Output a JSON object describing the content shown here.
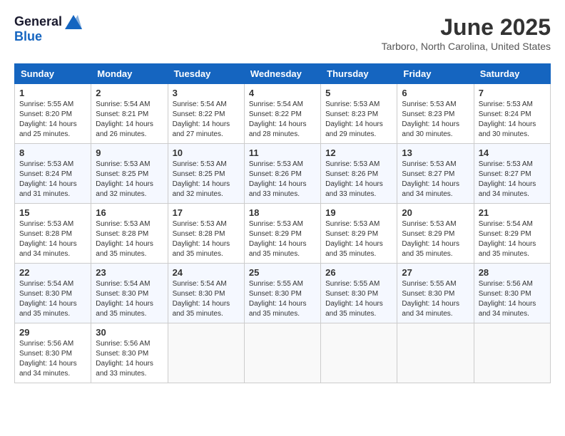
{
  "header": {
    "logo_general": "General",
    "logo_blue": "Blue",
    "title": "June 2025",
    "subtitle": "Tarboro, North Carolina, United States"
  },
  "weekdays": [
    "Sunday",
    "Monday",
    "Tuesday",
    "Wednesday",
    "Thursday",
    "Friday",
    "Saturday"
  ],
  "weeks": [
    [
      {
        "day": "1",
        "info": "Sunrise: 5:55 AM\nSunset: 8:20 PM\nDaylight: 14 hours\nand 25 minutes."
      },
      {
        "day": "2",
        "info": "Sunrise: 5:54 AM\nSunset: 8:21 PM\nDaylight: 14 hours\nand 26 minutes."
      },
      {
        "day": "3",
        "info": "Sunrise: 5:54 AM\nSunset: 8:22 PM\nDaylight: 14 hours\nand 27 minutes."
      },
      {
        "day": "4",
        "info": "Sunrise: 5:54 AM\nSunset: 8:22 PM\nDaylight: 14 hours\nand 28 minutes."
      },
      {
        "day": "5",
        "info": "Sunrise: 5:53 AM\nSunset: 8:23 PM\nDaylight: 14 hours\nand 29 minutes."
      },
      {
        "day": "6",
        "info": "Sunrise: 5:53 AM\nSunset: 8:23 PM\nDaylight: 14 hours\nand 30 minutes."
      },
      {
        "day": "7",
        "info": "Sunrise: 5:53 AM\nSunset: 8:24 PM\nDaylight: 14 hours\nand 30 minutes."
      }
    ],
    [
      {
        "day": "8",
        "info": "Sunrise: 5:53 AM\nSunset: 8:24 PM\nDaylight: 14 hours\nand 31 minutes."
      },
      {
        "day": "9",
        "info": "Sunrise: 5:53 AM\nSunset: 8:25 PM\nDaylight: 14 hours\nand 32 minutes."
      },
      {
        "day": "10",
        "info": "Sunrise: 5:53 AM\nSunset: 8:25 PM\nDaylight: 14 hours\nand 32 minutes."
      },
      {
        "day": "11",
        "info": "Sunrise: 5:53 AM\nSunset: 8:26 PM\nDaylight: 14 hours\nand 33 minutes."
      },
      {
        "day": "12",
        "info": "Sunrise: 5:53 AM\nSunset: 8:26 PM\nDaylight: 14 hours\nand 33 minutes."
      },
      {
        "day": "13",
        "info": "Sunrise: 5:53 AM\nSunset: 8:27 PM\nDaylight: 14 hours\nand 34 minutes."
      },
      {
        "day": "14",
        "info": "Sunrise: 5:53 AM\nSunset: 8:27 PM\nDaylight: 14 hours\nand 34 minutes."
      }
    ],
    [
      {
        "day": "15",
        "info": "Sunrise: 5:53 AM\nSunset: 8:28 PM\nDaylight: 14 hours\nand 34 minutes."
      },
      {
        "day": "16",
        "info": "Sunrise: 5:53 AM\nSunset: 8:28 PM\nDaylight: 14 hours\nand 35 minutes."
      },
      {
        "day": "17",
        "info": "Sunrise: 5:53 AM\nSunset: 8:28 PM\nDaylight: 14 hours\nand 35 minutes."
      },
      {
        "day": "18",
        "info": "Sunrise: 5:53 AM\nSunset: 8:29 PM\nDaylight: 14 hours\nand 35 minutes."
      },
      {
        "day": "19",
        "info": "Sunrise: 5:53 AM\nSunset: 8:29 PM\nDaylight: 14 hours\nand 35 minutes."
      },
      {
        "day": "20",
        "info": "Sunrise: 5:53 AM\nSunset: 8:29 PM\nDaylight: 14 hours\nand 35 minutes."
      },
      {
        "day": "21",
        "info": "Sunrise: 5:54 AM\nSunset: 8:29 PM\nDaylight: 14 hours\nand 35 minutes."
      }
    ],
    [
      {
        "day": "22",
        "info": "Sunrise: 5:54 AM\nSunset: 8:30 PM\nDaylight: 14 hours\nand 35 minutes."
      },
      {
        "day": "23",
        "info": "Sunrise: 5:54 AM\nSunset: 8:30 PM\nDaylight: 14 hours\nand 35 minutes."
      },
      {
        "day": "24",
        "info": "Sunrise: 5:54 AM\nSunset: 8:30 PM\nDaylight: 14 hours\nand 35 minutes."
      },
      {
        "day": "25",
        "info": "Sunrise: 5:55 AM\nSunset: 8:30 PM\nDaylight: 14 hours\nand 35 minutes."
      },
      {
        "day": "26",
        "info": "Sunrise: 5:55 AM\nSunset: 8:30 PM\nDaylight: 14 hours\nand 35 minutes."
      },
      {
        "day": "27",
        "info": "Sunrise: 5:55 AM\nSunset: 8:30 PM\nDaylight: 14 hours\nand 34 minutes."
      },
      {
        "day": "28",
        "info": "Sunrise: 5:56 AM\nSunset: 8:30 PM\nDaylight: 14 hours\nand 34 minutes."
      }
    ],
    [
      {
        "day": "29",
        "info": "Sunrise: 5:56 AM\nSunset: 8:30 PM\nDaylight: 14 hours\nand 34 minutes."
      },
      {
        "day": "30",
        "info": "Sunrise: 5:56 AM\nSunset: 8:30 PM\nDaylight: 14 hours\nand 33 minutes."
      },
      {
        "day": "",
        "info": ""
      },
      {
        "day": "",
        "info": ""
      },
      {
        "day": "",
        "info": ""
      },
      {
        "day": "",
        "info": ""
      },
      {
        "day": "",
        "info": ""
      }
    ]
  ]
}
